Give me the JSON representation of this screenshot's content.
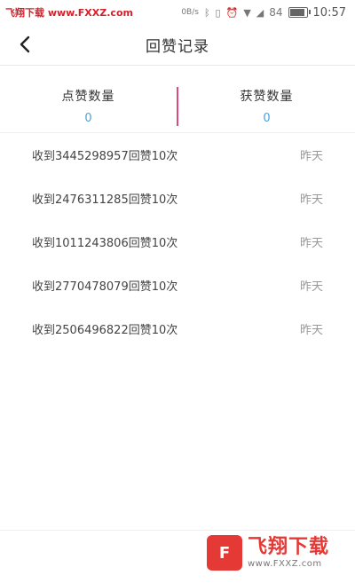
{
  "status_bar": {
    "watermark": "飞翔下载 www.FXXZ.com",
    "speed": "0B/s",
    "battery": "84",
    "time": "10:57"
  },
  "header": {
    "title": "回赞记录"
  },
  "stats": {
    "like_count_label": "点赞数量",
    "like_count_value": "0",
    "received_count_label": "获赞数量",
    "received_count_value": "0"
  },
  "records": [
    {
      "text": "收到3445298957回赞10次",
      "time": "昨天"
    },
    {
      "text": "收到2476311285回赞10次",
      "time": "昨天"
    },
    {
      "text": "收到1011243806回赞10次",
      "time": "昨天"
    },
    {
      "text": "收到2770478079回赞10次",
      "time": "昨天"
    },
    {
      "text": "收到2506496822回赞10次",
      "time": "昨天"
    }
  ],
  "watermark_logo": {
    "name": "飞翔下载",
    "url": "www.FXXZ.com"
  },
  "colors": {
    "accent_divider": "#e0457b",
    "stat_value": "#4aa3df"
  }
}
